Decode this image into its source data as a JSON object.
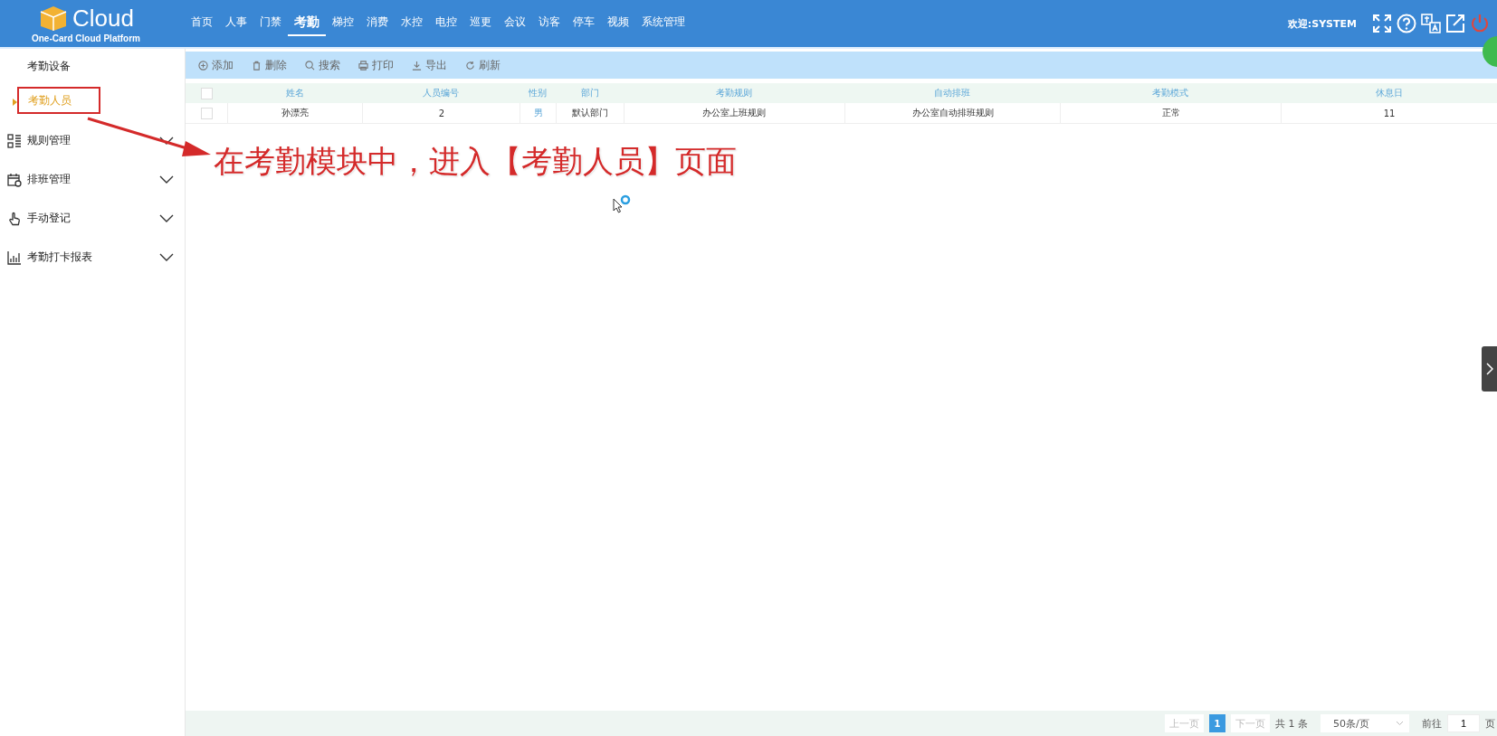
{
  "header": {
    "logo_title": "Cloud",
    "logo_subtitle": "One-Card Cloud Platform",
    "nav": [
      {
        "label": "首页",
        "selected": false
      },
      {
        "label": "人事",
        "selected": false
      },
      {
        "label": "门禁",
        "selected": false
      },
      {
        "label": "考勤",
        "selected": true
      },
      {
        "label": "梯控",
        "selected": false
      },
      {
        "label": "消费",
        "selected": false
      },
      {
        "label": "水控",
        "selected": false
      },
      {
        "label": "电控",
        "selected": false
      },
      {
        "label": "巡更",
        "selected": false
      },
      {
        "label": "会议",
        "selected": false
      },
      {
        "label": "访客",
        "selected": false
      },
      {
        "label": "停车",
        "selected": false
      },
      {
        "label": "视频",
        "selected": false
      },
      {
        "label": "系统管理",
        "selected": false
      }
    ],
    "welcome": "欢迎:SYSTEM"
  },
  "sidebar": {
    "items": [
      {
        "kind": "link",
        "label": "考勤设备",
        "selected": false
      },
      {
        "kind": "link",
        "label": "考勤人员",
        "selected": true
      },
      {
        "kind": "group",
        "label": "规则管理",
        "expanded": false
      },
      {
        "kind": "group",
        "label": "排班管理",
        "expanded": false
      },
      {
        "kind": "group",
        "label": "手动登记",
        "expanded": false
      },
      {
        "kind": "group",
        "label": "考勤打卡报表",
        "expanded": false
      }
    ]
  },
  "toolbar": [
    {
      "label": "添加"
    },
    {
      "label": "删除"
    },
    {
      "label": "搜索"
    },
    {
      "label": "打印"
    },
    {
      "label": "导出"
    },
    {
      "label": "刷新"
    }
  ],
  "table": {
    "select_all_checked": false,
    "columns": [
      "姓名",
      "人员编号",
      "性别",
      "部门",
      "考勤规则",
      "自动排班",
      "考勤模式",
      "休息日"
    ],
    "rows": [
      {
        "checked": false,
        "cells": [
          "孙漂亮",
          "2",
          "男",
          "默认部门",
          "办公室上班规则",
          "办公室自动排班规则",
          "正常",
          "11"
        ]
      }
    ]
  },
  "annotation": {
    "text": "在考勤模块中，进入【考勤人员】页面"
  },
  "pagination": {
    "prev": "上一页",
    "pages": [
      {
        "label": "1",
        "selected": true
      }
    ],
    "next": "下一页",
    "total": "共 1 条",
    "page_size": "50条/页",
    "goto_label": "前往",
    "goto_value": "1",
    "page_unit": "页"
  }
}
